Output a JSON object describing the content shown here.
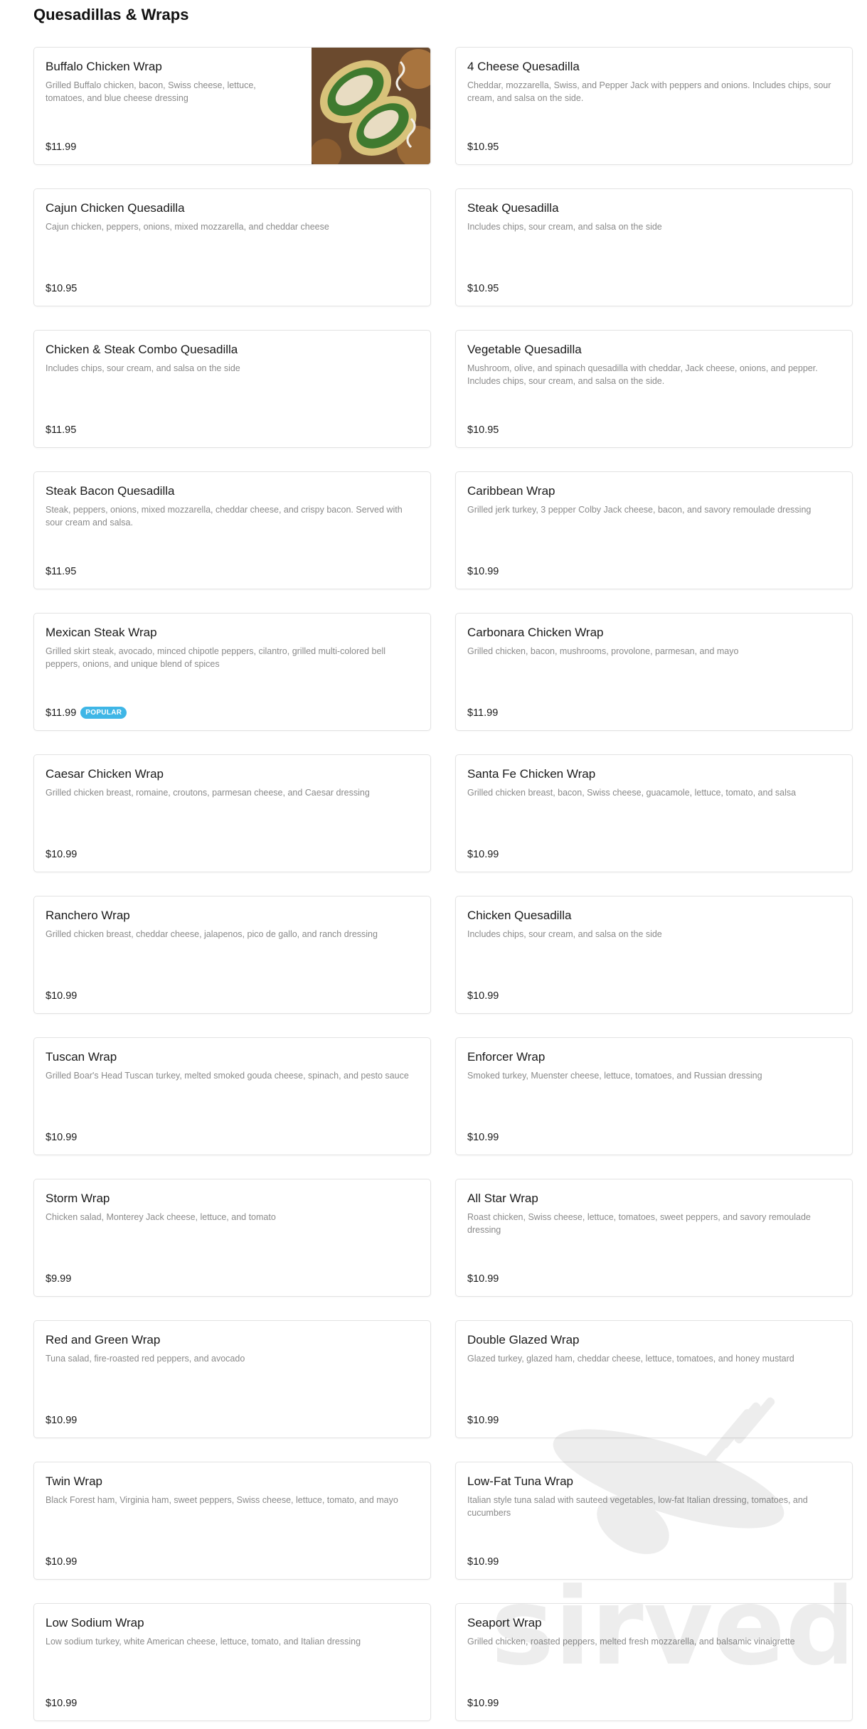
{
  "section": {
    "title": "Quesadillas & Wraps"
  },
  "watermark": {
    "text": "sirved"
  },
  "items": [
    {
      "name": "Buffalo Chicken Wrap",
      "description": "Grilled Buffalo chicken, bacon, Swiss cheese, lettuce, tomatoes, and blue cheese dressing",
      "price": "$11.99",
      "has_photo": true
    },
    {
      "name": "4 Cheese Quesadilla",
      "description": "Cheddar, mozzarella, Swiss, and Pepper Jack with peppers and onions. Includes chips, sour cream, and salsa on the side.",
      "price": "$10.95"
    },
    {
      "name": "Cajun Chicken Quesadilla",
      "description": "Cajun chicken, peppers, onions, mixed mozzarella, and cheddar cheese",
      "price": "$10.95"
    },
    {
      "name": "Steak Quesadilla",
      "description": "Includes chips, sour cream, and salsa on the side",
      "price": "$10.95"
    },
    {
      "name": "Chicken & Steak Combo Quesadilla",
      "description": "Includes chips, sour cream, and salsa on the side",
      "price": "$11.95"
    },
    {
      "name": "Vegetable Quesadilla",
      "description": "Mushroom, olive, and spinach quesadilla with cheddar, Jack cheese, onions, and pepper. Includes chips, sour cream, and salsa on the side.",
      "price": "$10.95"
    },
    {
      "name": "Steak Bacon Quesadilla",
      "description": "Steak, peppers, onions, mixed mozzarella, cheddar cheese, and crispy bacon. Served with sour cream and salsa.",
      "price": "$11.95"
    },
    {
      "name": "Caribbean Wrap",
      "description": "Grilled jerk turkey, 3 pepper Colby Jack cheese, bacon, and savory remoulade dressing",
      "price": "$10.99"
    },
    {
      "name": "Mexican Steak Wrap",
      "description": "Grilled skirt steak, avocado, minced chipotle peppers, cilantro, grilled multi-colored bell peppers, onions, and unique blend of spices",
      "price": "$11.99",
      "badge": "POPULAR"
    },
    {
      "name": "Carbonara Chicken Wrap",
      "description": "Grilled chicken, bacon, mushrooms, provolone, parmesan, and mayo",
      "price": "$11.99"
    },
    {
      "name": "Caesar Chicken Wrap",
      "description": "Grilled chicken breast, romaine, croutons, parmesan cheese, and Caesar dressing",
      "price": "$10.99"
    },
    {
      "name": "Santa Fe Chicken Wrap",
      "description": "Grilled chicken breast, bacon, Swiss cheese, guacamole, lettuce, tomato, and salsa",
      "price": "$10.99"
    },
    {
      "name": "Ranchero Wrap",
      "description": "Grilled chicken breast, cheddar cheese, jalapenos, pico de gallo, and ranch dressing",
      "price": "$10.99"
    },
    {
      "name": "Chicken Quesadilla",
      "description": "Includes chips, sour cream, and salsa on the side",
      "price": "$10.99"
    },
    {
      "name": "Tuscan Wrap",
      "description": "Grilled Boar's Head Tuscan turkey, melted smoked gouda cheese, spinach, and pesto sauce",
      "price": "$10.99"
    },
    {
      "name": "Enforcer Wrap",
      "description": "Smoked turkey, Muenster cheese, lettuce, tomatoes, and Russian dressing",
      "price": "$10.99"
    },
    {
      "name": "Storm Wrap",
      "description": "Chicken salad, Monterey Jack cheese, lettuce, and tomato",
      "price": "$9.99"
    },
    {
      "name": "All Star Wrap",
      "description": "Roast chicken, Swiss cheese, lettuce, tomatoes, sweet peppers, and savory remoulade dressing",
      "price": "$10.99"
    },
    {
      "name": "Red and Green Wrap",
      "description": "Tuna salad, fire-roasted red peppers, and avocado",
      "price": "$10.99"
    },
    {
      "name": "Double Glazed Wrap",
      "description": "Glazed turkey, glazed ham, cheddar cheese, lettuce, tomatoes, and honey mustard",
      "price": "$10.99"
    },
    {
      "name": "Twin Wrap",
      "description": "Black Forest ham, Virginia ham, sweet peppers, Swiss cheese, lettuce, tomato, and mayo",
      "price": "$10.99"
    },
    {
      "name": "Low-Fat Tuna Wrap",
      "description": "Italian style tuna salad with sauteed vegetables, low-fat Italian dressing, tomatoes, and cucumbers",
      "price": "$10.99"
    },
    {
      "name": "Low Sodium Wrap",
      "description": "Low sodium turkey, white American cheese, lettuce, tomato, and Italian dressing",
      "price": "$10.99"
    },
    {
      "name": "Seaport Wrap",
      "description": "Grilled chicken, roasted peppers, melted fresh mozzarella, and balsamic vinaigrette",
      "price": "$10.99"
    }
  ],
  "colors": {
    "badge": "#3fb6e6",
    "description_text": "#8a8a8a",
    "card_border": "#e3e3e3"
  }
}
